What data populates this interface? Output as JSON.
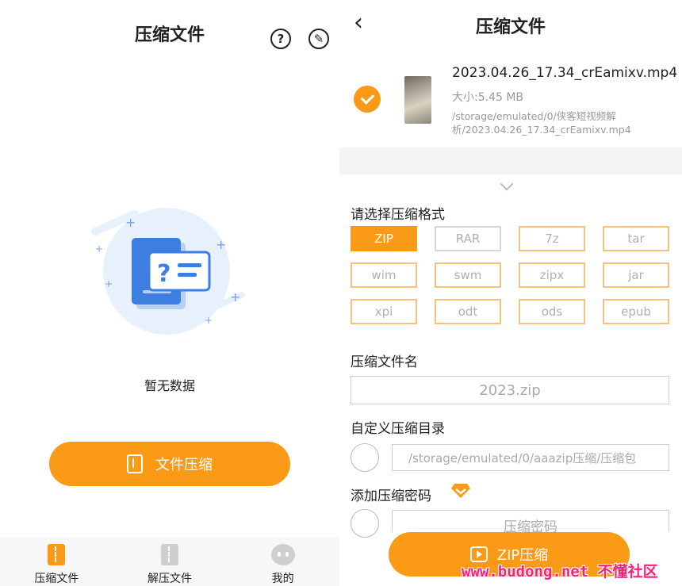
{
  "left": {
    "title": "压缩文件",
    "help_icon": "question-circle-icon",
    "edit_icon": "edit-circle-icon",
    "empty_text": "暂无数据",
    "compress_button": "文件压缩",
    "nav": [
      {
        "label": "压缩文件",
        "icon": "zip-file-icon",
        "active": true
      },
      {
        "label": "解压文件",
        "icon": "unzip-file-icon",
        "active": false
      },
      {
        "label": "我的",
        "icon": "profile-face-icon",
        "active": false
      }
    ]
  },
  "right": {
    "title": "压缩文件",
    "back_icon": "back-chevron-icon",
    "file": {
      "name": "2023.04.26_17.34_crEamixv.mp4",
      "size": "大小:5.45 MB",
      "path": "/storage/emulated/0/侠客短视频解析/2023.04.26_17.34_crEamixv.mp4"
    },
    "format_label": "请选择压缩格式",
    "formats": [
      "ZIP",
      "RAR",
      "7z",
      "tar",
      "wim",
      "swm",
      "zipx",
      "jar",
      "xpi",
      "odt",
      "ods",
      "epub"
    ],
    "selected_format": "ZIP",
    "filename_label": "压缩文件名",
    "filename_value": "2023.zip",
    "dir_label": "自定义压缩目录",
    "dir_value": "/storage/emulated/0/aaazip压缩/压缩包",
    "password_label": "添加压缩密码",
    "password_placeholder": "压缩密码",
    "zip_button": "ZIP压缩"
  },
  "watermark": "www.budong.net 不懂社区",
  "colors": {
    "accent": "#fb9a17",
    "watermark": "#ff1f7a"
  }
}
